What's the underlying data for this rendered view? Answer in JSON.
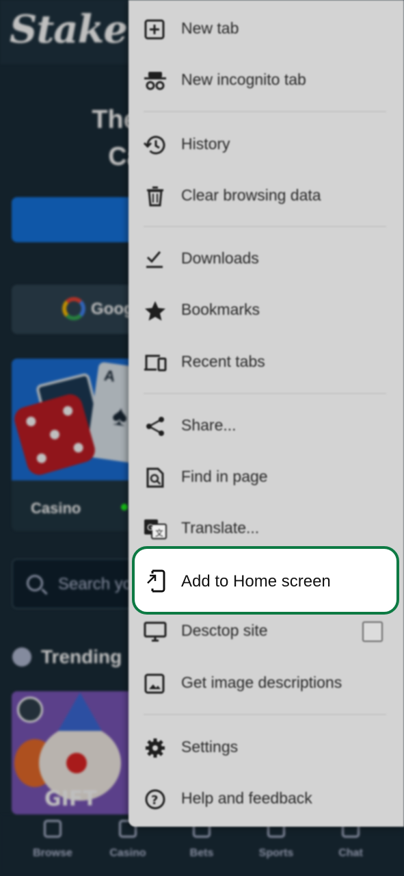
{
  "site": {
    "logo": "Stake",
    "hero_line1": "The Wor",
    "hero_line2": "Casin",
    "google_button_text": "Goog",
    "casino_card_label": "Casino",
    "search_placeholder": "Search yo",
    "trending_label": "Trending",
    "game_tile_text": "GIFT",
    "bottom_nav": [
      {
        "label": "Browse",
        "icon": "browse-icon"
      },
      {
        "label": "Casino",
        "icon": "cards-icon"
      },
      {
        "label": "Bets",
        "icon": "bets-icon"
      },
      {
        "label": "Sports",
        "icon": "sports-icon"
      },
      {
        "label": "Chat",
        "icon": "chat-icon"
      }
    ]
  },
  "menu": {
    "items": [
      {
        "label": "New tab",
        "icon": "new-tab-icon"
      },
      {
        "label": "New incognito tab",
        "icon": "incognito-icon"
      },
      {
        "label": "History",
        "icon": "history-icon"
      },
      {
        "label": "Clear browsing data",
        "icon": "trash-icon"
      },
      {
        "label": "Downloads",
        "icon": "download-icon"
      },
      {
        "label": "Bookmarks",
        "icon": "star-icon"
      },
      {
        "label": "Recent tabs",
        "icon": "devices-icon"
      },
      {
        "label": "Share...",
        "icon": "share-icon"
      },
      {
        "label": "Find in page",
        "icon": "find-in-page-icon"
      },
      {
        "label": "Translate...",
        "icon": "translate-icon"
      },
      {
        "label": "Add to Home screen",
        "icon": "add-to-home-icon",
        "highlighted": true
      },
      {
        "label": "Desctop site",
        "icon": "monitor-icon",
        "checkbox": false
      },
      {
        "label": "Get image descriptions",
        "icon": "image-icon"
      },
      {
        "label": "Settings",
        "icon": "gear-icon"
      },
      {
        "label": "Help and feedback",
        "icon": "help-icon"
      }
    ],
    "highlight_color": "#0d7a43"
  },
  "colors": {
    "site_background": "#1a2c38",
    "primary_button": "#1475e1",
    "menu_background": "#d3d3d3"
  }
}
